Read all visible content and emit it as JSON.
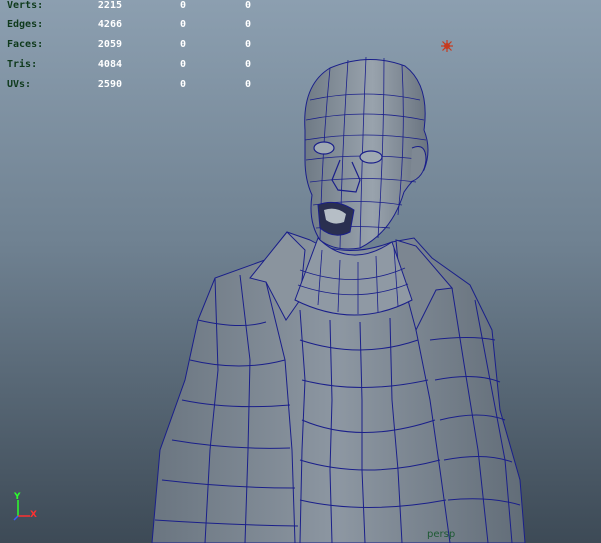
{
  "hud": {
    "rows": [
      {
        "label": "Verts:",
        "v1": "2215",
        "v2": "0",
        "v3": "0"
      },
      {
        "label": "Edges:",
        "v1": "4266",
        "v2": "0",
        "v3": "0"
      },
      {
        "label": "Faces:",
        "v1": "2059",
        "v2": "0",
        "v3": "0"
      },
      {
        "label": "Tris:",
        "v1": "4084",
        "v2": "0",
        "v3": "0"
      },
      {
        "label": "UVs:",
        "v1": "2590",
        "v2": "0",
        "v3": "0"
      }
    ]
  },
  "axis": {
    "y": "Y",
    "x": "X"
  },
  "camera": {
    "name": "persp"
  },
  "colors": {
    "wire": "#1a1f8a",
    "mesh": "#7f8a96",
    "hud_label": "#0f3a1c",
    "axis_y": "#2cff2c",
    "axis_x": "#ff3030",
    "light": "#c83a1e"
  }
}
